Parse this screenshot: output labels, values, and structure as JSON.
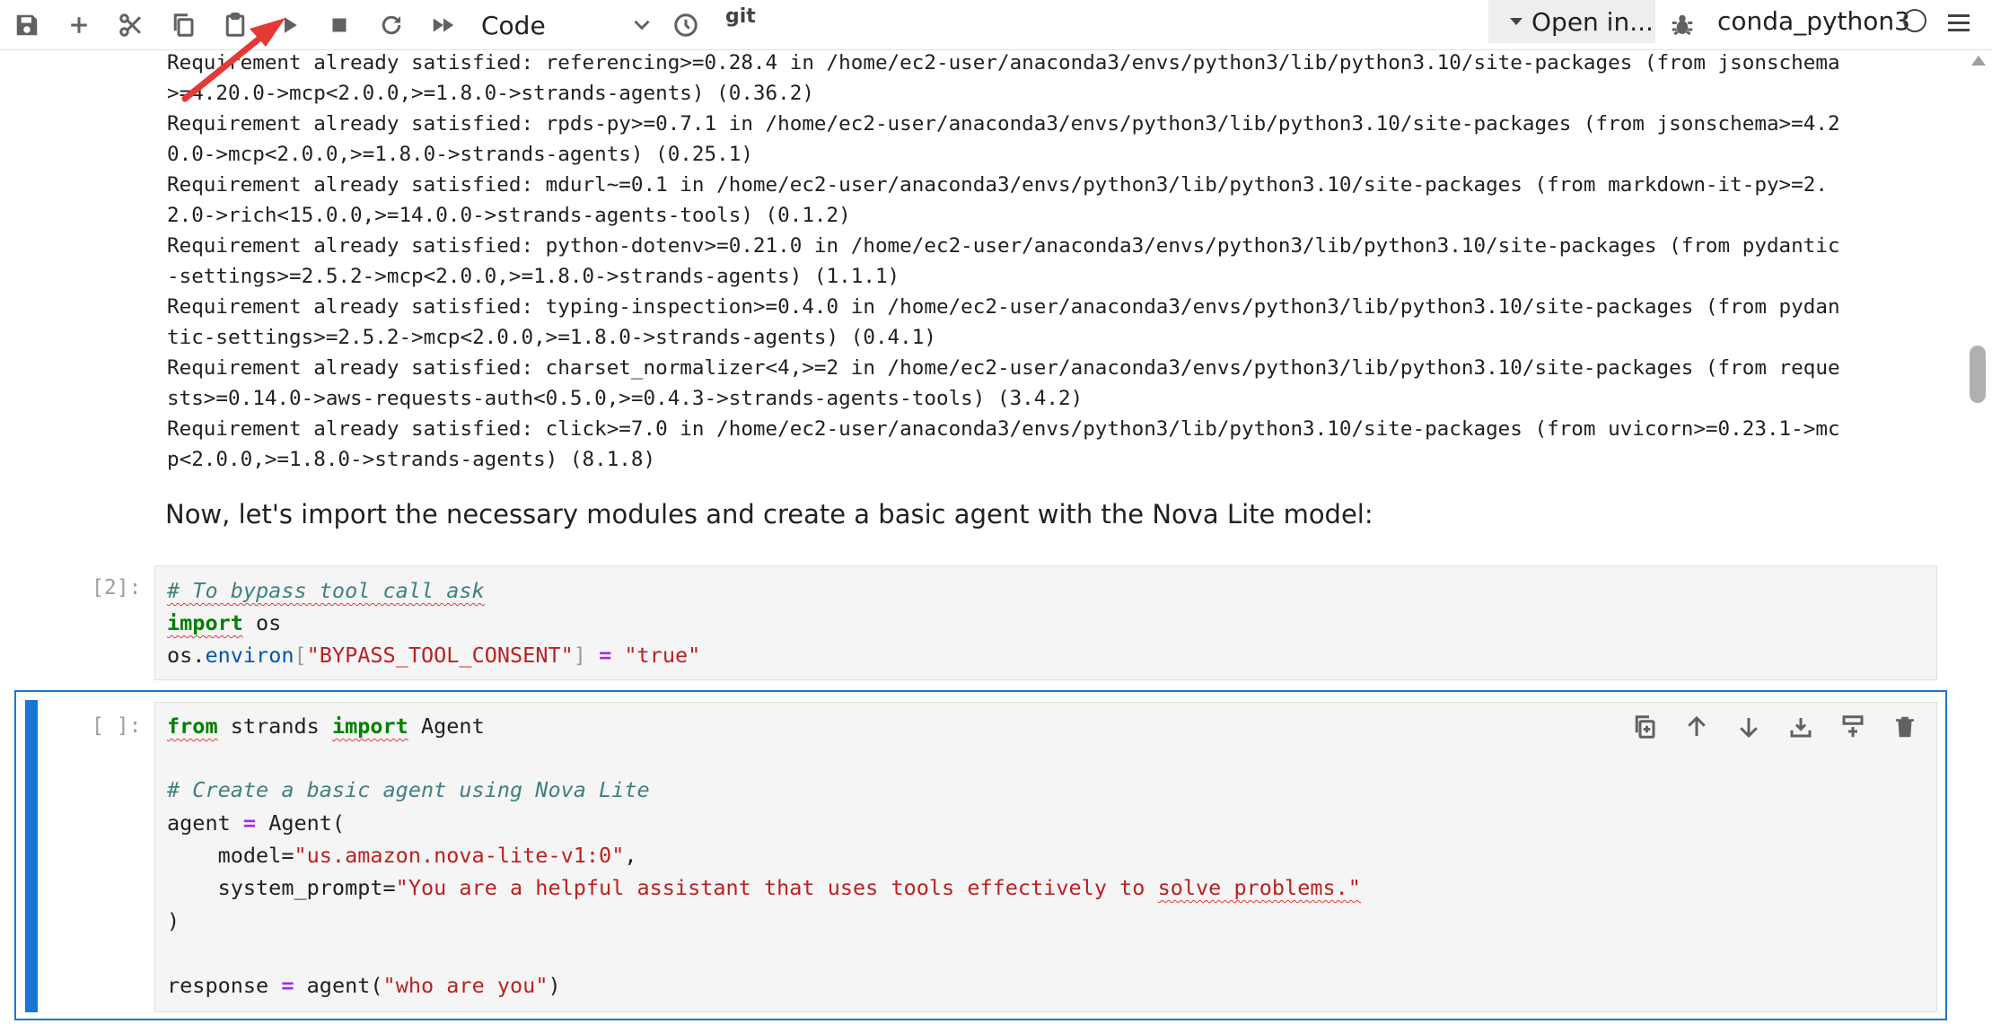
{
  "toolbar": {
    "cell_type": "Code",
    "git_label": "git",
    "open_in_label": "Open in...",
    "kernel_name": "conda_python3",
    "icons": [
      "save-icon",
      "add-icon",
      "cut-icon",
      "copy-icon",
      "paste-icon",
      "run-icon",
      "stop-icon",
      "restart-icon",
      "fast-forward-icon",
      "clock-icon",
      "bug-icon",
      "menu-icon"
    ]
  },
  "output_lines": [
    "Requirement already satisfied: referencing>=0.28.4 in /home/ec2-user/anaconda3/envs/python3/lib/python3.10/site-packages (from jsonschema",
    ">=4.20.0->mcp<2.0.0,>=1.8.0->strands-agents) (0.36.2)",
    "Requirement already satisfied: rpds-py>=0.7.1 in /home/ec2-user/anaconda3/envs/python3/lib/python3.10/site-packages (from jsonschema>=4.2",
    "0.0->mcp<2.0.0,>=1.8.0->strands-agents) (0.25.1)",
    "Requirement already satisfied: mdurl~=0.1 in /home/ec2-user/anaconda3/envs/python3/lib/python3.10/site-packages (from markdown-it-py>=2.",
    "2.0->rich<15.0.0,>=14.0.0->strands-agents-tools) (0.1.2)",
    "Requirement already satisfied: python-dotenv>=0.21.0 in /home/ec2-user/anaconda3/envs/python3/lib/python3.10/site-packages (from pydantic",
    "-settings>=2.5.2->mcp<2.0.0,>=1.8.0->strands-agents) (1.1.1)",
    "Requirement already satisfied: typing-inspection>=0.4.0 in /home/ec2-user/anaconda3/envs/python3/lib/python3.10/site-packages (from pydan",
    "tic-settings>=2.5.2->mcp<2.0.0,>=1.8.0->strands-agents) (0.4.1)",
    "Requirement already satisfied: charset_normalizer<4,>=2 in /home/ec2-user/anaconda3/envs/python3/lib/python3.10/site-packages (from reque",
    "sts>=0.14.0->aws-requests-auth<0.5.0,>=0.4.3->strands-agents-tools) (3.4.2)",
    "Requirement already satisfied: click>=7.0 in /home/ec2-user/anaconda3/envs/python3/lib/python3.10/site-packages (from uvicorn>=0.23.1->mc",
    "p<2.0.0,>=1.8.0->strands-agents) (8.1.8)"
  ],
  "markdown_text": "Now, let's import the necessary modules and create a basic agent with the Nova Lite model:",
  "cell2": {
    "prompt": "[2]:",
    "comment": "# To bypass tool call ask",
    "kw_import": "import",
    "module": " os",
    "environ_obj": "os.",
    "environ_attr": "environ",
    "bracket_open": "[",
    "env_key": "\"BYPASS_TOOL_CONSENT\"",
    "bracket_close": "]",
    "assign": " = ",
    "env_value": "\"true\""
  },
  "cell3": {
    "prompt": "[ ]:",
    "kw_from": "from",
    "module": " strands ",
    "kw_import": "import",
    "class_name": " Agent",
    "comment": "# Create a basic agent using Nova Lite",
    "agent_var": "agent ",
    "eq": "=",
    "agent_call": " Agent(",
    "model_arg": "    model=",
    "model_value": "\"us.amazon.nova-lite-v1:0\"",
    "model_comma": ",",
    "prompt_arg": "    system_prompt=",
    "prompt_value_a": "\"You are a helpful assistant that uses tools effectively to ",
    "prompt_value_b": "solve problems.\"",
    "close_paren": ")",
    "response_var": "response ",
    "response_call": " agent(",
    "response_value": "\"who are you\"",
    "response_close": ")"
  },
  "colors": {
    "accent": "#1976d2",
    "keyword": "#008000",
    "comment": "#408080",
    "string": "#ba2121",
    "operator": "#aa22ff",
    "annotation_arrow": "#e53935"
  }
}
